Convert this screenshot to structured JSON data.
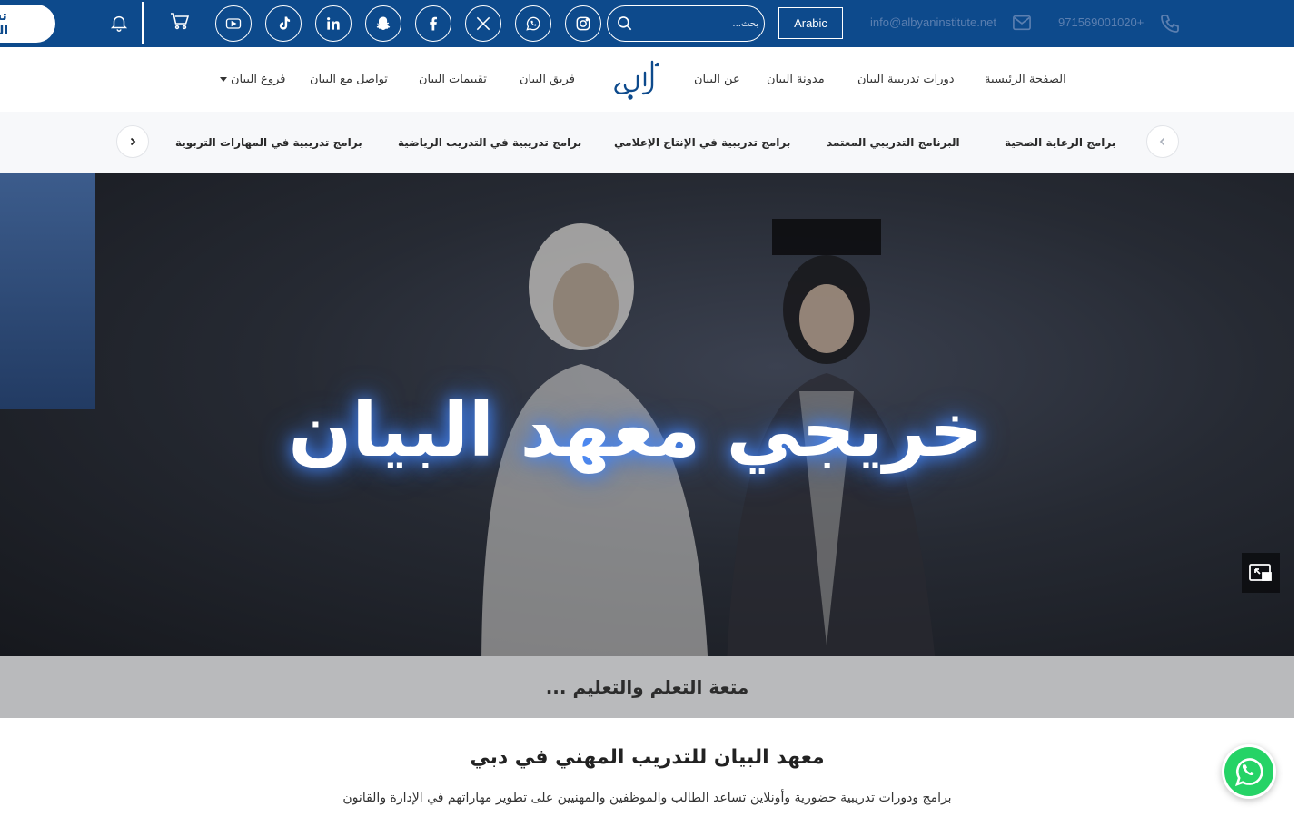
{
  "topbar": {
    "register_label": "تسجيل الدخول",
    "search_placeholder": "بحث...",
    "language_label": "Arabic",
    "email": "info@albyaninstitute.net",
    "phone": "971569001020+",
    "social_icons": [
      "youtube-icon",
      "tiktok-icon",
      "linkedin-icon",
      "snapchat-icon",
      "facebook-icon",
      "x-icon",
      "whatsapp-icon",
      "instagram-icon"
    ]
  },
  "nav": {
    "items": [
      "الصفحة الرئيسية",
      "دورات تدريبية البيان",
      "مدونة البيان",
      "عن البيان",
      "فريق البيان",
      "تقييمات البيان",
      "تواصل مع البيان",
      "فروع البيان"
    ]
  },
  "categories": {
    "items": [
      "برامج الرعاية الصحية",
      "البرنامج التدريبي المعتمد",
      "برامج تدريبية في الإنتاج الإعلامي",
      "برامج تدريبية في التدريب الرياضية",
      "برامج تدريبية في المهارات التربوية"
    ]
  },
  "hero": {
    "title": "خريجي معهد البيان",
    "tagline": "متعة التعلم والتعليم ..."
  },
  "intro": {
    "title": "معهد البيان للتدريب المهني في دبي",
    "text": "برامج ودورات تدريبية حضورية وأونلاين تساعد الطالب والموظفين والمهنيين على تطوير مهاراتهم في الإدارة والقانون"
  },
  "colors": {
    "topbar": "#0d4a8c",
    "whatsapp": "#25d366"
  }
}
